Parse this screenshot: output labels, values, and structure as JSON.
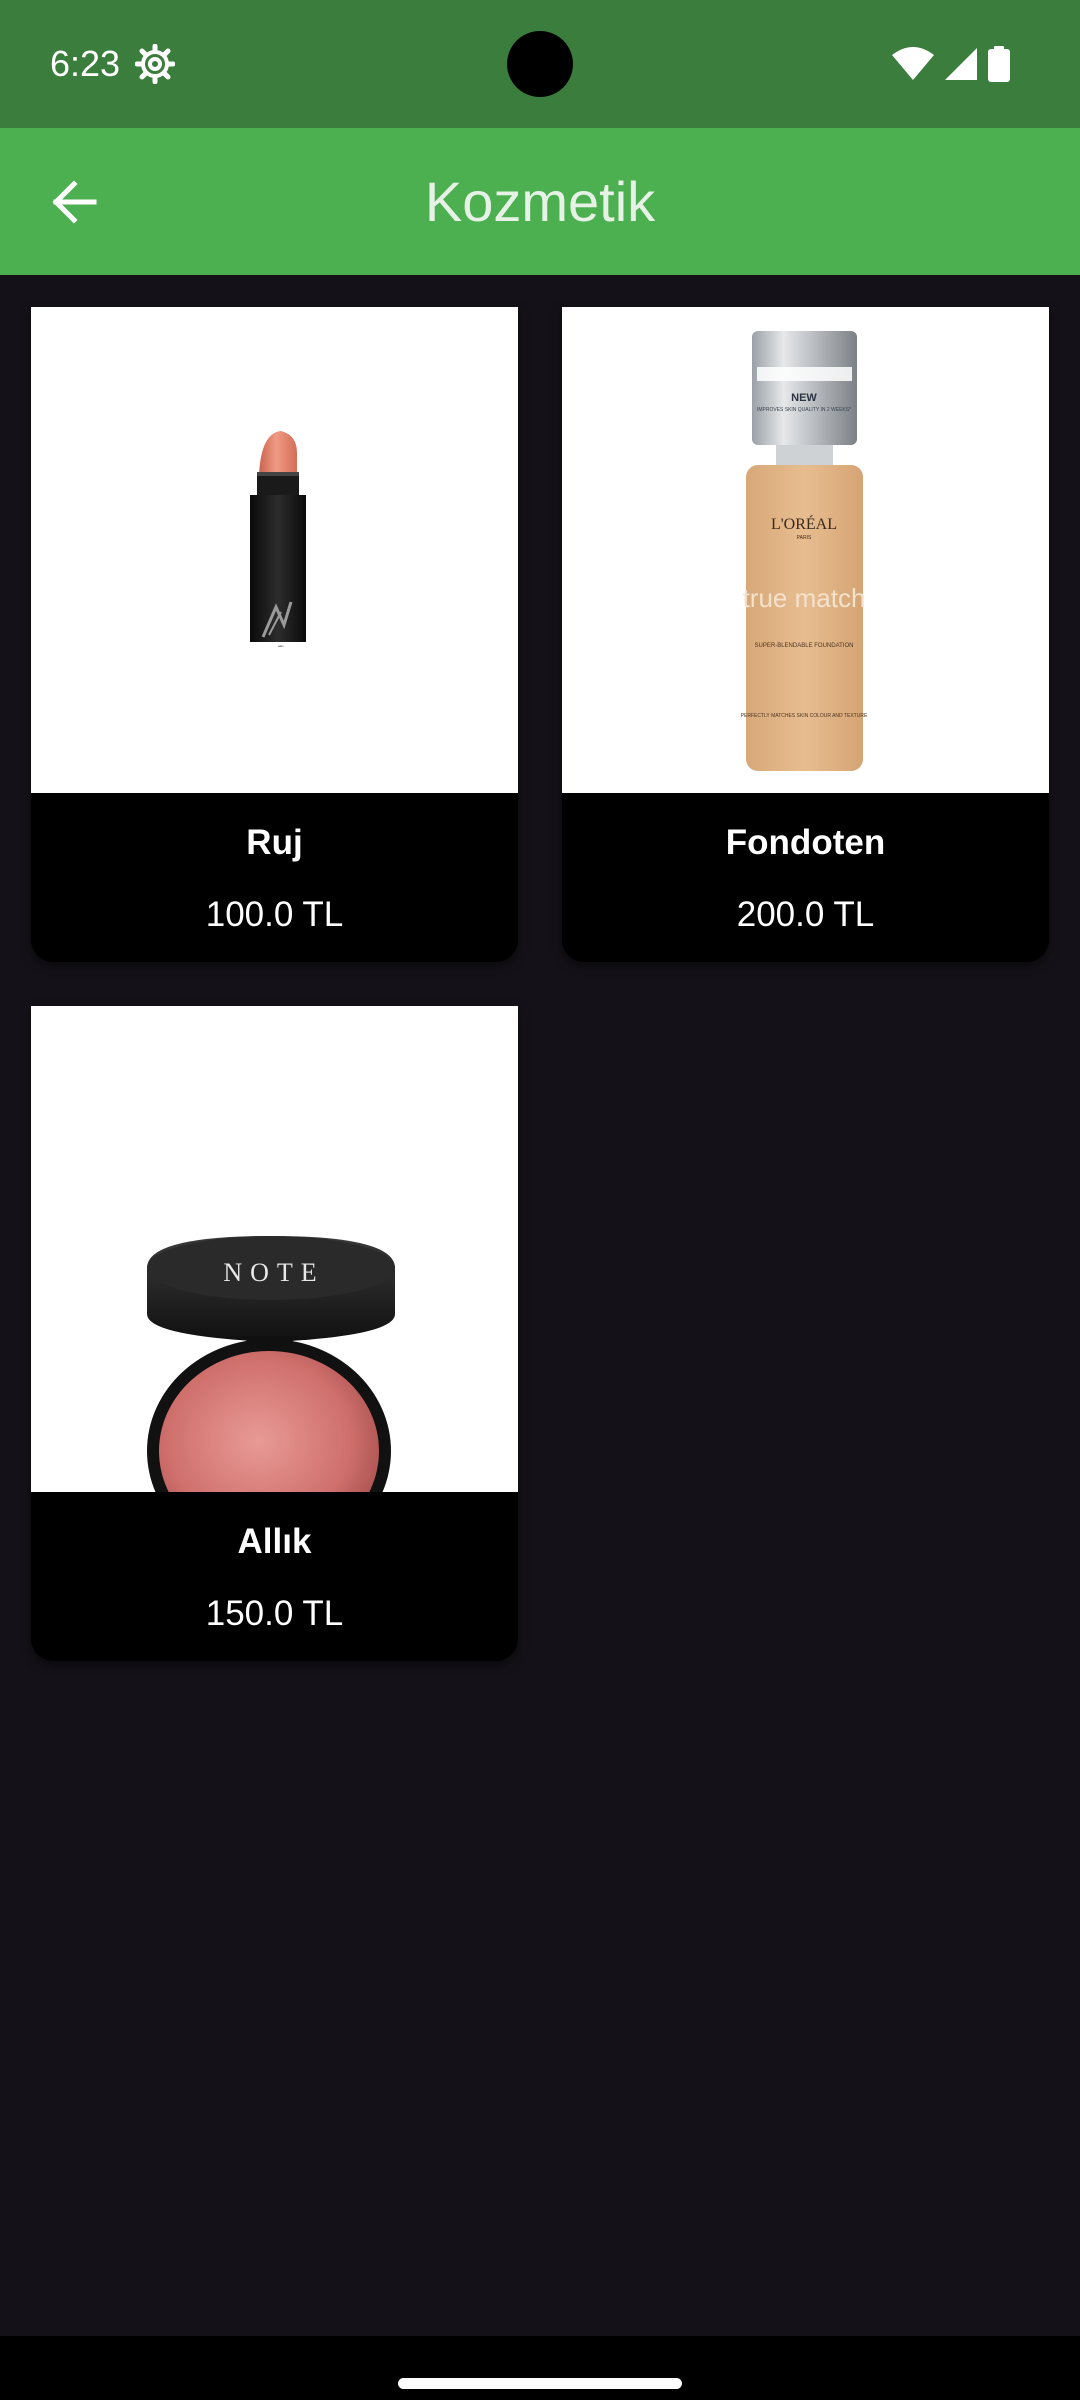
{
  "status_bar": {
    "time": "6:23",
    "icons": [
      "settings-gear-icon",
      "wifi-icon",
      "signal-icon",
      "battery-icon"
    ]
  },
  "app_bar": {
    "title": "Kozmetik",
    "back_icon": "arrow-back-icon",
    "color": "#4caf50"
  },
  "products": [
    {
      "name": "Ruj",
      "price": "100.0 TL",
      "image": "lipstick"
    },
    {
      "name": "Fondoten",
      "price": "200.0 TL",
      "image": "foundation-bottle"
    },
    {
      "name": "Allık",
      "price": "150.0 TL",
      "image": "blush-compact"
    }
  ],
  "images": {
    "lipstick_brand": "NARS",
    "foundation": {
      "badge": "NEW",
      "badge_sub": "IMPROVES SKIN QUALITY IN 2 WEEKS*",
      "brand": "L'ORÉAL",
      "brand_sub": "PARIS",
      "product": "true match",
      "product_sub": "SUPER-BLENDABLE FOUNDATION",
      "footnote": "PERFECTLY MATCHES SKIN COLOUR AND TEXTURE"
    },
    "blush_brand": "NOTE"
  },
  "colors": {
    "background": "#141218",
    "status_bar": "#3a7d3c",
    "card": "#000000"
  }
}
